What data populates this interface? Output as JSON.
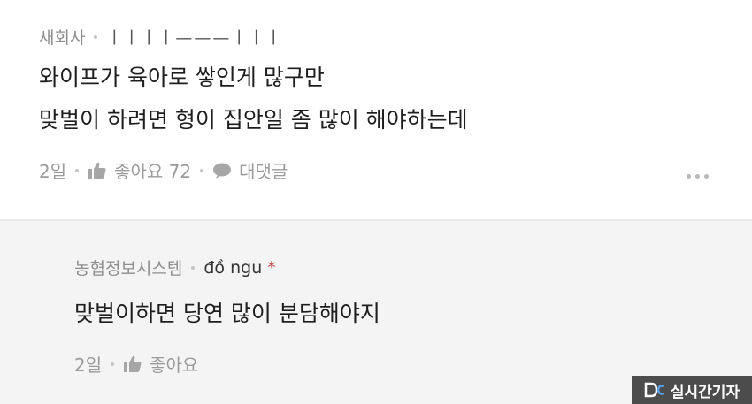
{
  "comment": {
    "author": "새회사",
    "author_suffix": "ㅣㅣㅣㅣ———ㅣㅣㅣ",
    "lines": [
      "와이프가 육아로 쌓인게 많구만",
      "맞벌이 하려면 형이 집안일 좀 많이 해야하는데"
    ],
    "time": "2일",
    "like_label": "좋아요 72",
    "reply_label": "대댓글",
    "icons": {
      "like": "thumbs-up-icon",
      "reply": "speech-bubble-icon",
      "more": "more-dots-icon"
    }
  },
  "reply": {
    "author": "농협정보시스템",
    "nickname": "đồ ngu",
    "badge": "*",
    "text": "맞벌이하면 당연 많이 분담해야지",
    "time": "2일",
    "like_label": "좋아요"
  },
  "watermark": {
    "text": "실시간기자",
    "icon": "dc-logo-icon"
  },
  "colors": {
    "reply_bg": "#f4f4f4",
    "badge": "#d0363e",
    "watermark_bg": "#4c4c4c"
  }
}
